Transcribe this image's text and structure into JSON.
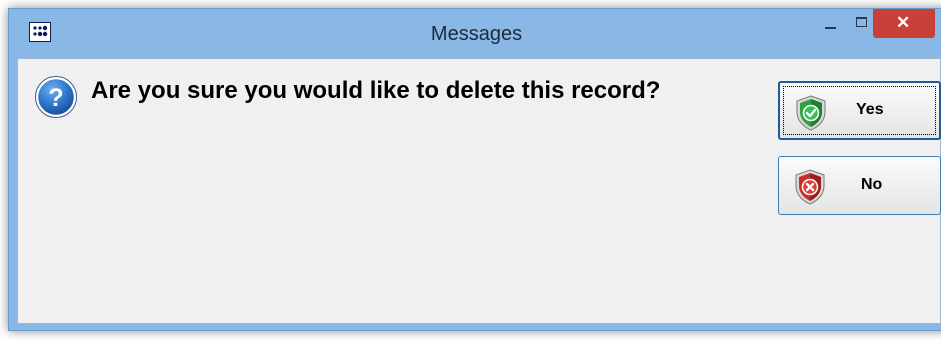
{
  "window": {
    "title": "Messages",
    "controls": {
      "minimize_icon": "minimize-icon",
      "maximize_icon": "maximize-icon",
      "close_icon": "close-icon",
      "close_color": "#c7403a"
    }
  },
  "dialog": {
    "icon": "question-icon",
    "message": "Are you sure you would like to delete this record?",
    "buttons": {
      "yes_label": "Yes",
      "yes_icon": "green-check-shield-icon",
      "no_label": "No",
      "no_icon": "red-x-shield-icon"
    }
  },
  "colors": {
    "titlebar": "#8ab8e6",
    "client_background": "#f0f0f0",
    "button_border": "#3c7fb1"
  }
}
